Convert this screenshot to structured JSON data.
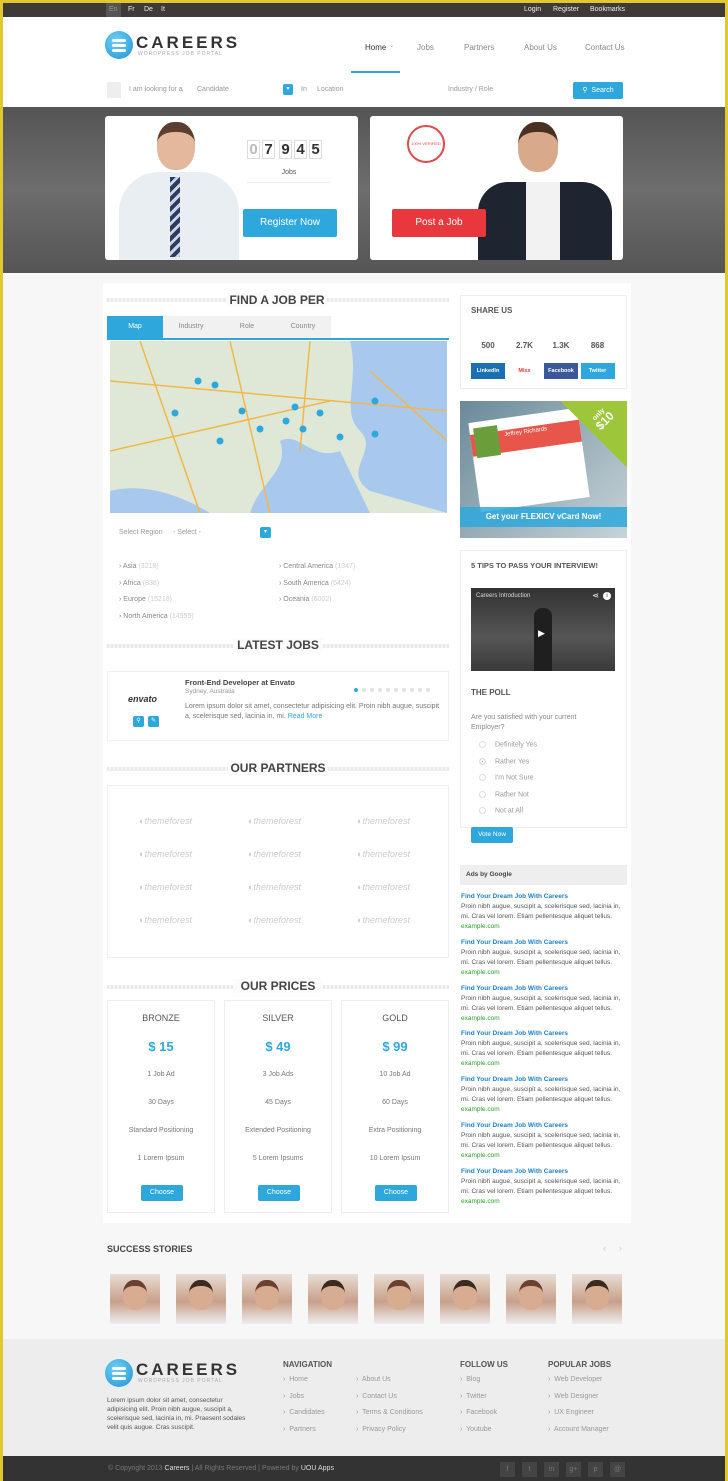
{
  "topbar": {
    "languages": [
      "En",
      "Fr",
      "De",
      "It"
    ],
    "links": [
      "Login",
      "Register",
      "Bookmarks"
    ]
  },
  "brand": {
    "name": "CAREERS",
    "tagline": "WORDPRESS JOB PORTAL"
  },
  "nav": {
    "items": [
      "Home",
      "Jobs",
      "Partners",
      "About Us",
      "Contact Us"
    ],
    "active": "Home"
  },
  "search": {
    "looking_label": "I am looking for a",
    "type_value": "Candidate",
    "in_label": "In",
    "location_placeholder": "Location",
    "industry_placeholder": "Industry / Role",
    "button": "Search"
  },
  "hero": {
    "counter_digits": [
      "0",
      "7",
      "9",
      "4",
      "5"
    ],
    "counter_label": "Jobs",
    "register_button": "Register Now",
    "stamp_text": "100% VERIFIED",
    "post_button": "Post a Job"
  },
  "find_job": {
    "title": "FIND A JOB PER",
    "tabs": [
      "Map",
      "Industry",
      "Role",
      "Country"
    ],
    "active_tab": "Map",
    "select_label": "Select Region",
    "select_value": "- Select -",
    "regions": [
      {
        "name": "Asia",
        "count": "(3218)"
      },
      {
        "name": "Africa",
        "count": "(838)"
      },
      {
        "name": "Europe",
        "count": "(15218)"
      },
      {
        "name": "North America",
        "count": "(14955)"
      },
      {
        "name": "Central America",
        "count": "(1347)"
      },
      {
        "name": "South America",
        "count": "(5424)"
      },
      {
        "name": "Oceania",
        "count": "(6002)"
      }
    ]
  },
  "latest_jobs": {
    "title": "LATEST JOBS",
    "job": {
      "company_logo": "envato",
      "title": "Front-End Developer at Envato",
      "location": "Sydney, Australia",
      "description": "Lorem ipsum dolor sit amet, consectetur adipisicing elit. Proin nibh augue, suscipit a, scelerisque sed, lacinia in, mi.",
      "read_more": "Read More"
    },
    "pages": 10,
    "current_page": 1
  },
  "partners": {
    "title": "OUR PARTNERS",
    "logos": [
      "themeforest",
      "themeforest",
      "themeforest",
      "themeforest",
      "themeforest",
      "themeforest",
      "themeforest",
      "themeforest",
      "themeforest",
      "themeforest",
      "themeforest",
      "themeforest"
    ]
  },
  "prices": {
    "title": "OUR PRICES",
    "plans": [
      {
        "name": "BRONZE",
        "price": "$ 15",
        "features": [
          "1 Job Ad",
          "30 Days",
          "Standard Positioning",
          "1 Lorem Ipsum"
        ],
        "button": "Choose"
      },
      {
        "name": "SILVER",
        "price": "$ 49",
        "features": [
          "3 Job Ads",
          "45 Days",
          "Extended Positioning",
          "5 Lorem Ipsums"
        ],
        "button": "Choose"
      },
      {
        "name": "GOLD",
        "price": "$ 99",
        "features": [
          "10 Job Ad",
          "60 Days",
          "Extra Positioning",
          "10 Lorem Ipsum"
        ],
        "button": "Choose"
      }
    ]
  },
  "share": {
    "title": "SHARE US",
    "items": [
      {
        "count": "500",
        "label": "LinkedIn",
        "color": "#1a6fb0"
      },
      {
        "count": "2.7K",
        "label": "Mixx",
        "color": "#e8383d"
      },
      {
        "count": "1.3K",
        "label": "Facebook",
        "color": "#3b5998"
      },
      {
        "count": "868",
        "label": "Twitter",
        "color": "#2ea8dc"
      }
    ]
  },
  "promo": {
    "badge_top": "only",
    "badge_price": "$10",
    "name": "Jeffrey Richards",
    "cta": "Get your FLEXICV vCard Now!"
  },
  "tips": {
    "title": "5 TIPS TO PASS YOUR INTERVIEW!",
    "video_title": "Careers Introduction"
  },
  "poll": {
    "title": "THE POLL",
    "question": "Are you satisfied with your current Employer?",
    "options": [
      "Definitely Yes",
      "Rather Yes",
      "I'm Not Sure",
      "Rather Not",
      "Not at All"
    ],
    "selected": "Rather Yes",
    "button": "Vote Now"
  },
  "ads": {
    "header": "Ads by Google",
    "items": [
      {
        "title": "Find Your Dream Job With Careers",
        "text": "Proin nibh augue, suscipit a, scelerisque sed, lacinia in, mi. Cras vel lorem. Etiam pellentesque aliquet tellus.",
        "url": "example.com"
      },
      {
        "title": "Find Your Dream Job With Careers",
        "text": "Proin nibh augue, suscipit a, scelerisque sed, lacinia in, mi. Cras vel lorem. Etiam pellentesque aliquet tellus.",
        "url": "example.com"
      },
      {
        "title": "Find Your Dream Job With Careers",
        "text": "Proin nibh augue, suscipit a, scelerisque sed, lacinia in, mi. Cras vel lorem. Etiam pellentesque aliquet tellus.",
        "url": "example.com"
      },
      {
        "title": "Find Your Dream Job With Careers",
        "text": "Proin nibh augue, suscipit a, scelerisque sed, lacinia in, mi. Cras vel lorem. Etiam pellentesque aliquet tellus.",
        "url": "example.com"
      },
      {
        "title": "Find Your Dream Job With Careers",
        "text": "Proin nibh augue, suscipit a, scelerisque sed, lacinia in, mi. Cras vel lorem. Etiam pellentesque aliquet tellus.",
        "url": "example.com"
      },
      {
        "title": "Find Your Dream Job With Careers",
        "text": "Proin nibh augue, suscipit a, scelerisque sed, lacinia in, mi. Cras vel lorem. Etiam pellentesque aliquet tellus.",
        "url": "example.com"
      },
      {
        "title": "Find Your Dream Job With Careers",
        "text": "Proin nibh augue, suscipit a, scelerisque sed, lacinia in, mi. Cras vel lorem. Etiam pellentesque aliquet tellus.",
        "url": "example.com"
      }
    ]
  },
  "stories": {
    "title": "SUCCESS STORIES",
    "count": 8
  },
  "footer": {
    "about": "Lorem ipsum dolor sit amet, consectetur adipisicing elit. Proin nibh augue, suscipit a, scelerisque sed, lacinia in, mi. Praesent sodales velit quis augue. Cras suscipit.",
    "navigation_title": "NAVIGATION",
    "navigation": [
      "Home",
      "Jobs",
      "Candidates",
      "Partners",
      "About Us",
      "Contact Us",
      "Terms & Conditions",
      "Privacy Policy"
    ],
    "follow_title": "FOLLOW US",
    "follow": [
      "Blog",
      "Twitter",
      "Facebook",
      "Youtube"
    ],
    "popular_title": "POPULAR JOBS",
    "popular": [
      "Web Developer",
      "Web Designer",
      "UX Engineer",
      "Account Manager"
    ],
    "copyright": "© Copyright 2013",
    "copyright_brand": "Careers",
    "copyright_rest": "| All Rights Reserved | Powered by",
    "powered": "UOU Apps",
    "social_icons": [
      "f",
      "t",
      "in",
      "g+",
      "p",
      "@"
    ]
  },
  "colors": {
    "accent": "#2ea8dc",
    "danger": "#e8383d",
    "topbar": "#3d3a38"
  }
}
